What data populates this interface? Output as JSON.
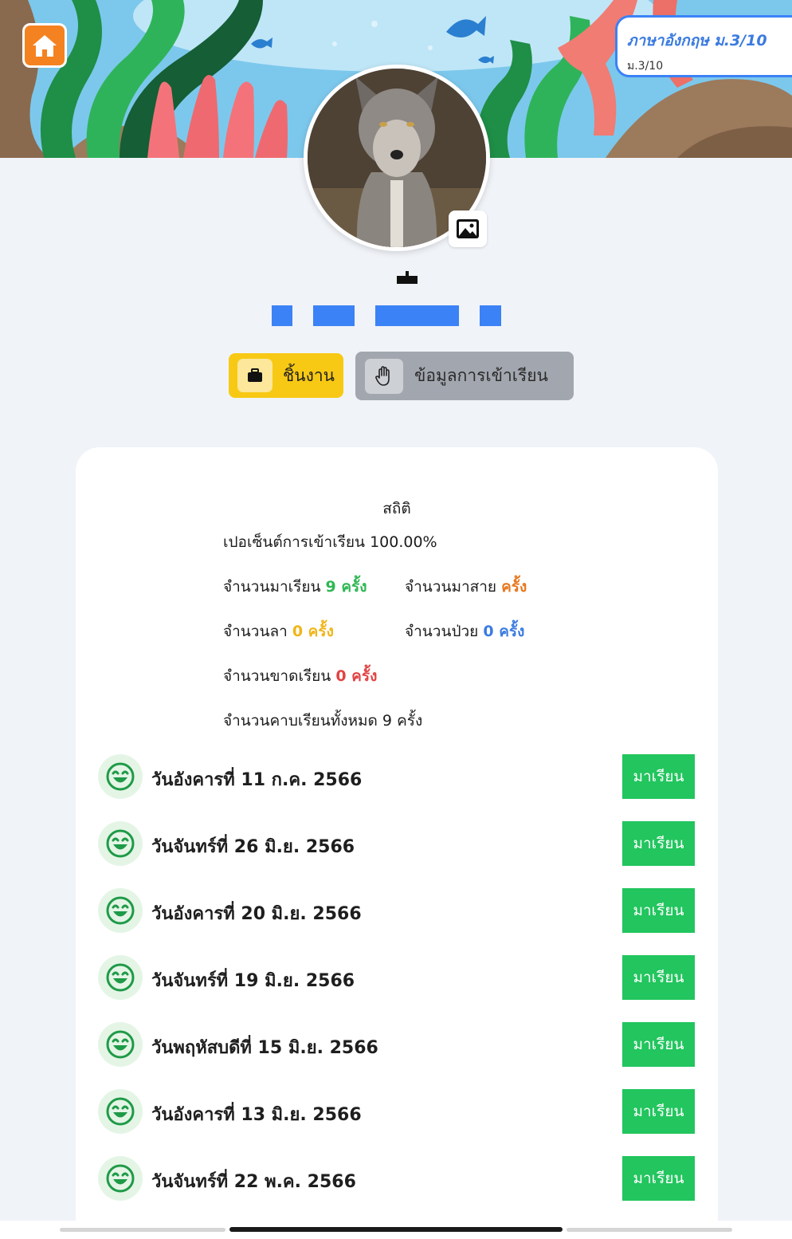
{
  "header": {
    "class_title": "ภาษาอังกฤษ ม.3/10",
    "class_level": "ม.3/10"
  },
  "tabs": {
    "work_label": "ชิ้นงาน",
    "attendance_label": "ข้อมูลการเข้าเรียน"
  },
  "stats": {
    "title": "สถิติ",
    "percent_label": "เปอเซ็นต์การเข้าเรียน 100.00%",
    "present_label": "จำนวนมาเรียน",
    "present_value": "9 ครั้ง",
    "late_label": "จำนวนมาสาย",
    "late_value": "ครั้ง",
    "leave_label": "จำนวนลา",
    "leave_value": "0 ครั้ง",
    "sick_label": "จำนวนป่วย",
    "sick_value": "0 ครั้ง",
    "absent_label": "จำนวนขาดเรียน",
    "absent_value": "0 ครั้ง",
    "total_label": "จำนวนคาบเรียนทั้งหมด 9 ครั้ง"
  },
  "records": [
    {
      "date": "วันอังคารที่ 11 ก.ค. 2566",
      "status": "มาเรียน"
    },
    {
      "date": "วันจันทร์ที่ 26 มิ.ย. 2566",
      "status": "มาเรียน"
    },
    {
      "date": "วันอังคารที่ 20 มิ.ย. 2566",
      "status": "มาเรียน"
    },
    {
      "date": "วันจันทร์ที่ 19 มิ.ย. 2566",
      "status": "มาเรียน"
    },
    {
      "date": "วันพฤหัสบดีที่ 15 มิ.ย. 2566",
      "status": "มาเรียน"
    },
    {
      "date": "วันอังคารที่ 13 มิ.ย. 2566",
      "status": "มาเรียน"
    },
    {
      "date": "วันจันทร์ที่ 22 พ.ค. 2566",
      "status": "มาเรียน"
    }
  ],
  "icons": {
    "home": "home-icon",
    "image": "image-icon",
    "briefcase": "briefcase-icon",
    "hand": "hand-icon",
    "smile": "smile-icon"
  },
  "colors": {
    "home": "#f58220",
    "work_tab": "#f8c914",
    "attendance_tab": "#a2a6ae",
    "present": "#2eb752",
    "late": "#e7771d",
    "leave": "#f0b51a",
    "sick": "#3b7be0",
    "absent": "#e14343",
    "status_button": "#22c55e"
  }
}
